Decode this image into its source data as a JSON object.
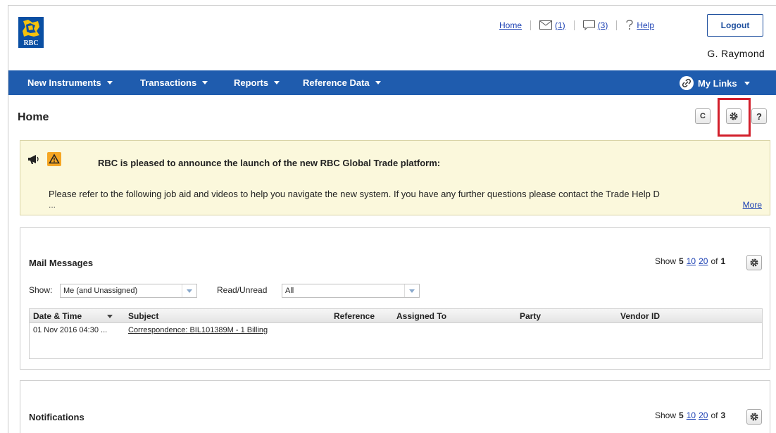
{
  "header": {
    "logo_text": "RBC",
    "home_link": "Home",
    "mail_count": "(1)",
    "chat_count": "(3)",
    "help_link": "Help",
    "logout_label": "Logout",
    "user_name": "G. Raymond"
  },
  "nav": {
    "items": [
      {
        "label": "New Instruments"
      },
      {
        "label": "Transactions"
      },
      {
        "label": "Reports"
      },
      {
        "label": "Reference Data"
      }
    ],
    "my_links": "My Links"
  },
  "page": {
    "title": "Home",
    "tools": {
      "refresh": "C",
      "settings": "gear",
      "help": "?"
    }
  },
  "announcement": {
    "heading": "RBC is pleased to announce the launch of the new RBC Global Trade platform:",
    "body": "Please refer to the following job aid and videos to help you navigate the new system. If you have any further questions please contact the Trade Help D",
    "ellipsis": "...",
    "more_link": "More"
  },
  "mail": {
    "title": "Mail Messages",
    "show_label": "Show",
    "page_size_current": "5",
    "page_size_opt1": "10",
    "page_size_opt2": "20",
    "of_label": "of",
    "total_pages": "1",
    "filter_show_label": "Show:",
    "filter_show_value": "Me (and Unassigned)",
    "filter_read_label": "Read/Unread",
    "filter_read_value": "All",
    "columns": [
      "Date & Time",
      "Subject",
      "Reference",
      "Assigned To",
      "Party",
      "Vendor ID"
    ],
    "rows": [
      {
        "date": "01 Nov 2016 04:30 ...",
        "subject": "Correspondence: BIL101389M - 1 Billing"
      }
    ]
  },
  "notifications": {
    "title": "Notifications",
    "show_label": "Show",
    "page_size_current": "5",
    "page_size_opt1": "10",
    "page_size_opt2": "20",
    "of_label": "of",
    "total_pages": "3"
  },
  "colors": {
    "nav_blue": "#1f5cae",
    "link_blue": "#1a3fb3",
    "highlight_red": "#d21e2a",
    "announce_bg": "#fbf8dc",
    "warning_orange": "#f5a623"
  }
}
